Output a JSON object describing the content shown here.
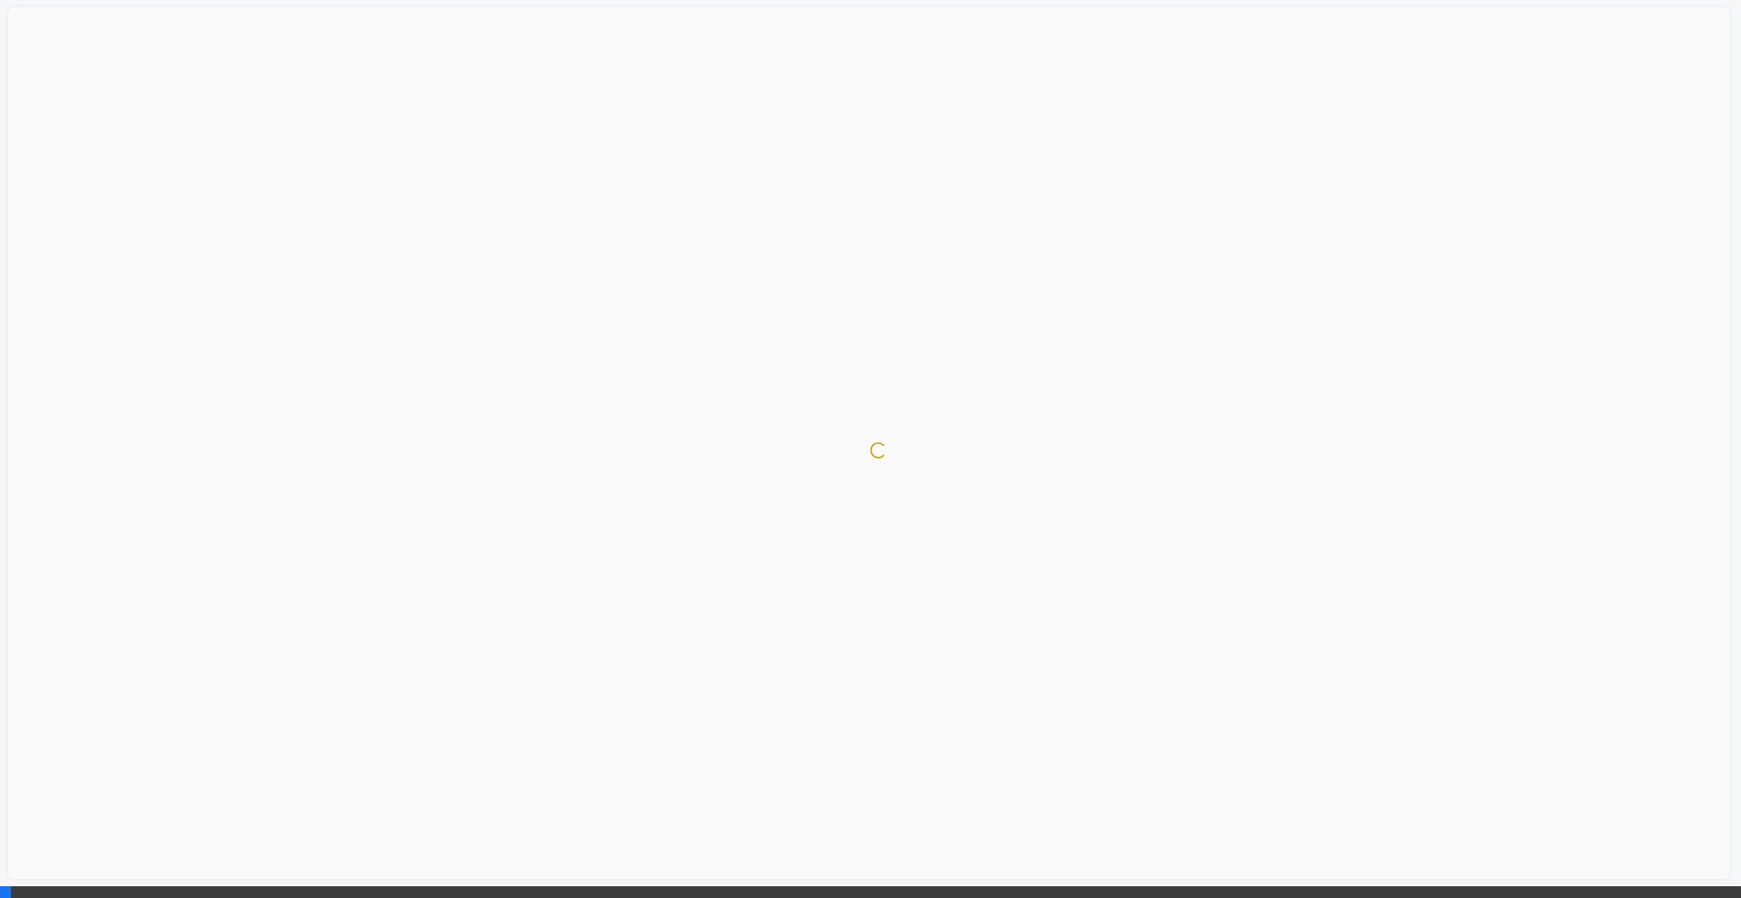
{
  "loading": {
    "icon": "loading-spinner-icon",
    "color": "#c99a1a"
  },
  "colors": {
    "background": "#fafafa",
    "status_bar": "#3c3c3c",
    "status_accent": "#1a73f0"
  }
}
